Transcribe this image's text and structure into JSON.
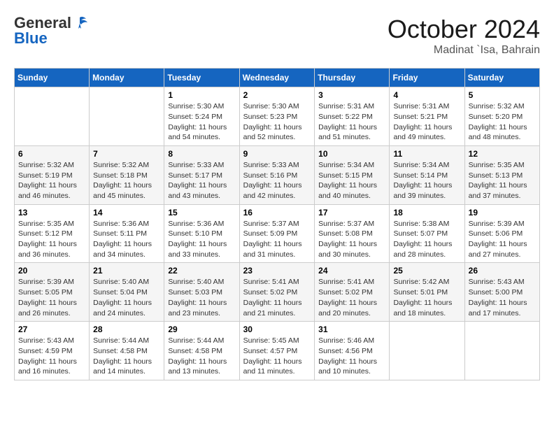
{
  "logo": {
    "general": "General",
    "blue": "Blue"
  },
  "title": "October 2024",
  "location": "Madinat `Isa, Bahrain",
  "days_header": [
    "Sunday",
    "Monday",
    "Tuesday",
    "Wednesday",
    "Thursday",
    "Friday",
    "Saturday"
  ],
  "weeks": [
    [
      {
        "day": "",
        "sunrise": "",
        "sunset": "",
        "daylight": ""
      },
      {
        "day": "",
        "sunrise": "",
        "sunset": "",
        "daylight": ""
      },
      {
        "day": "1",
        "sunrise": "Sunrise: 5:30 AM",
        "sunset": "Sunset: 5:24 PM",
        "daylight": "Daylight: 11 hours and 54 minutes."
      },
      {
        "day": "2",
        "sunrise": "Sunrise: 5:30 AM",
        "sunset": "Sunset: 5:23 PM",
        "daylight": "Daylight: 11 hours and 52 minutes."
      },
      {
        "day": "3",
        "sunrise": "Sunrise: 5:31 AM",
        "sunset": "Sunset: 5:22 PM",
        "daylight": "Daylight: 11 hours and 51 minutes."
      },
      {
        "day": "4",
        "sunrise": "Sunrise: 5:31 AM",
        "sunset": "Sunset: 5:21 PM",
        "daylight": "Daylight: 11 hours and 49 minutes."
      },
      {
        "day": "5",
        "sunrise": "Sunrise: 5:32 AM",
        "sunset": "Sunset: 5:20 PM",
        "daylight": "Daylight: 11 hours and 48 minutes."
      }
    ],
    [
      {
        "day": "6",
        "sunrise": "Sunrise: 5:32 AM",
        "sunset": "Sunset: 5:19 PM",
        "daylight": "Daylight: 11 hours and 46 minutes."
      },
      {
        "day": "7",
        "sunrise": "Sunrise: 5:32 AM",
        "sunset": "Sunset: 5:18 PM",
        "daylight": "Daylight: 11 hours and 45 minutes."
      },
      {
        "day": "8",
        "sunrise": "Sunrise: 5:33 AM",
        "sunset": "Sunset: 5:17 PM",
        "daylight": "Daylight: 11 hours and 43 minutes."
      },
      {
        "day": "9",
        "sunrise": "Sunrise: 5:33 AM",
        "sunset": "Sunset: 5:16 PM",
        "daylight": "Daylight: 11 hours and 42 minutes."
      },
      {
        "day": "10",
        "sunrise": "Sunrise: 5:34 AM",
        "sunset": "Sunset: 5:15 PM",
        "daylight": "Daylight: 11 hours and 40 minutes."
      },
      {
        "day": "11",
        "sunrise": "Sunrise: 5:34 AM",
        "sunset": "Sunset: 5:14 PM",
        "daylight": "Daylight: 11 hours and 39 minutes."
      },
      {
        "day": "12",
        "sunrise": "Sunrise: 5:35 AM",
        "sunset": "Sunset: 5:13 PM",
        "daylight": "Daylight: 11 hours and 37 minutes."
      }
    ],
    [
      {
        "day": "13",
        "sunrise": "Sunrise: 5:35 AM",
        "sunset": "Sunset: 5:12 PM",
        "daylight": "Daylight: 11 hours and 36 minutes."
      },
      {
        "day": "14",
        "sunrise": "Sunrise: 5:36 AM",
        "sunset": "Sunset: 5:11 PM",
        "daylight": "Daylight: 11 hours and 34 minutes."
      },
      {
        "day": "15",
        "sunrise": "Sunrise: 5:36 AM",
        "sunset": "Sunset: 5:10 PM",
        "daylight": "Daylight: 11 hours and 33 minutes."
      },
      {
        "day": "16",
        "sunrise": "Sunrise: 5:37 AM",
        "sunset": "Sunset: 5:09 PM",
        "daylight": "Daylight: 11 hours and 31 minutes."
      },
      {
        "day": "17",
        "sunrise": "Sunrise: 5:37 AM",
        "sunset": "Sunset: 5:08 PM",
        "daylight": "Daylight: 11 hours and 30 minutes."
      },
      {
        "day": "18",
        "sunrise": "Sunrise: 5:38 AM",
        "sunset": "Sunset: 5:07 PM",
        "daylight": "Daylight: 11 hours and 28 minutes."
      },
      {
        "day": "19",
        "sunrise": "Sunrise: 5:39 AM",
        "sunset": "Sunset: 5:06 PM",
        "daylight": "Daylight: 11 hours and 27 minutes."
      }
    ],
    [
      {
        "day": "20",
        "sunrise": "Sunrise: 5:39 AM",
        "sunset": "Sunset: 5:05 PM",
        "daylight": "Daylight: 11 hours and 26 minutes."
      },
      {
        "day": "21",
        "sunrise": "Sunrise: 5:40 AM",
        "sunset": "Sunset: 5:04 PM",
        "daylight": "Daylight: 11 hours and 24 minutes."
      },
      {
        "day": "22",
        "sunrise": "Sunrise: 5:40 AM",
        "sunset": "Sunset: 5:03 PM",
        "daylight": "Daylight: 11 hours and 23 minutes."
      },
      {
        "day": "23",
        "sunrise": "Sunrise: 5:41 AM",
        "sunset": "Sunset: 5:02 PM",
        "daylight": "Daylight: 11 hours and 21 minutes."
      },
      {
        "day": "24",
        "sunrise": "Sunrise: 5:41 AM",
        "sunset": "Sunset: 5:02 PM",
        "daylight": "Daylight: 11 hours and 20 minutes."
      },
      {
        "day": "25",
        "sunrise": "Sunrise: 5:42 AM",
        "sunset": "Sunset: 5:01 PM",
        "daylight": "Daylight: 11 hours and 18 minutes."
      },
      {
        "day": "26",
        "sunrise": "Sunrise: 5:43 AM",
        "sunset": "Sunset: 5:00 PM",
        "daylight": "Daylight: 11 hours and 17 minutes."
      }
    ],
    [
      {
        "day": "27",
        "sunrise": "Sunrise: 5:43 AM",
        "sunset": "Sunset: 4:59 PM",
        "daylight": "Daylight: 11 hours and 16 minutes."
      },
      {
        "day": "28",
        "sunrise": "Sunrise: 5:44 AM",
        "sunset": "Sunset: 4:58 PM",
        "daylight": "Daylight: 11 hours and 14 minutes."
      },
      {
        "day": "29",
        "sunrise": "Sunrise: 5:44 AM",
        "sunset": "Sunset: 4:58 PM",
        "daylight": "Daylight: 11 hours and 13 minutes."
      },
      {
        "day": "30",
        "sunrise": "Sunrise: 5:45 AM",
        "sunset": "Sunset: 4:57 PM",
        "daylight": "Daylight: 11 hours and 11 minutes."
      },
      {
        "day": "31",
        "sunrise": "Sunrise: 5:46 AM",
        "sunset": "Sunset: 4:56 PM",
        "daylight": "Daylight: 11 hours and 10 minutes."
      },
      {
        "day": "",
        "sunrise": "",
        "sunset": "",
        "daylight": ""
      },
      {
        "day": "",
        "sunrise": "",
        "sunset": "",
        "daylight": ""
      }
    ]
  ]
}
